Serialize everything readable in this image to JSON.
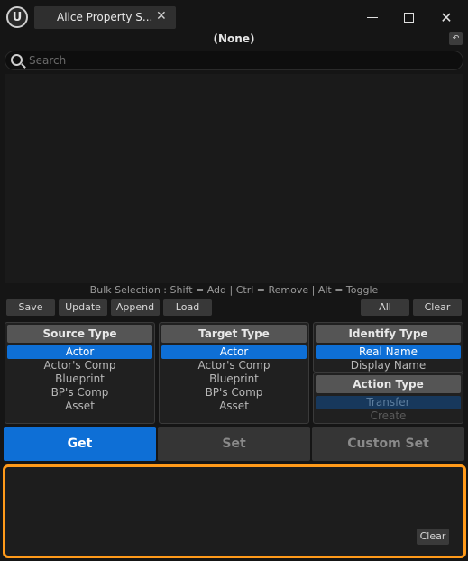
{
  "window": {
    "tab_title": "Alice Property S...",
    "logo_glyph": "U",
    "tab_close_glyph": "✕",
    "close_glyph": "✕"
  },
  "selection": {
    "current": "(None)",
    "reset_glyph": "↶"
  },
  "search": {
    "placeholder": "Search",
    "value": ""
  },
  "bulk_hint": "Bulk Selection : Shift = Add | Ctrl = Remove | Alt = Toggle",
  "toolbar": {
    "save": "Save",
    "update": "Update",
    "append": "Append",
    "load": "Load",
    "all": "All",
    "clear": "Clear"
  },
  "source_type": {
    "title": "Source Type",
    "options": [
      "Actor",
      "Actor's Comp",
      "Blueprint",
      "BP's Comp",
      "Asset"
    ],
    "selected": "Actor"
  },
  "target_type": {
    "title": "Target Type",
    "options": [
      "Actor",
      "Actor's Comp",
      "Blueprint",
      "BP's Comp",
      "Asset"
    ],
    "selected": "Actor"
  },
  "identify_type": {
    "title": "Identify Type",
    "options": [
      "Real Name",
      "Display Name"
    ],
    "selected": "Real Name"
  },
  "action_type": {
    "title": "Action Type",
    "options": [
      "Transfer",
      "Create"
    ],
    "selected": "Transfer"
  },
  "actions": {
    "get": "Get",
    "set": "Set",
    "custom_set": "Custom Set"
  },
  "log": {
    "clear": "Clear"
  },
  "colors": {
    "accent": "#0e6fd6",
    "log_border": "#ff9a1a",
    "background": "#151515"
  },
  "icons": [
    "unreal-logo-icon",
    "close-icon",
    "minimize-icon",
    "maximize-icon",
    "reset-icon",
    "search-icon"
  ]
}
